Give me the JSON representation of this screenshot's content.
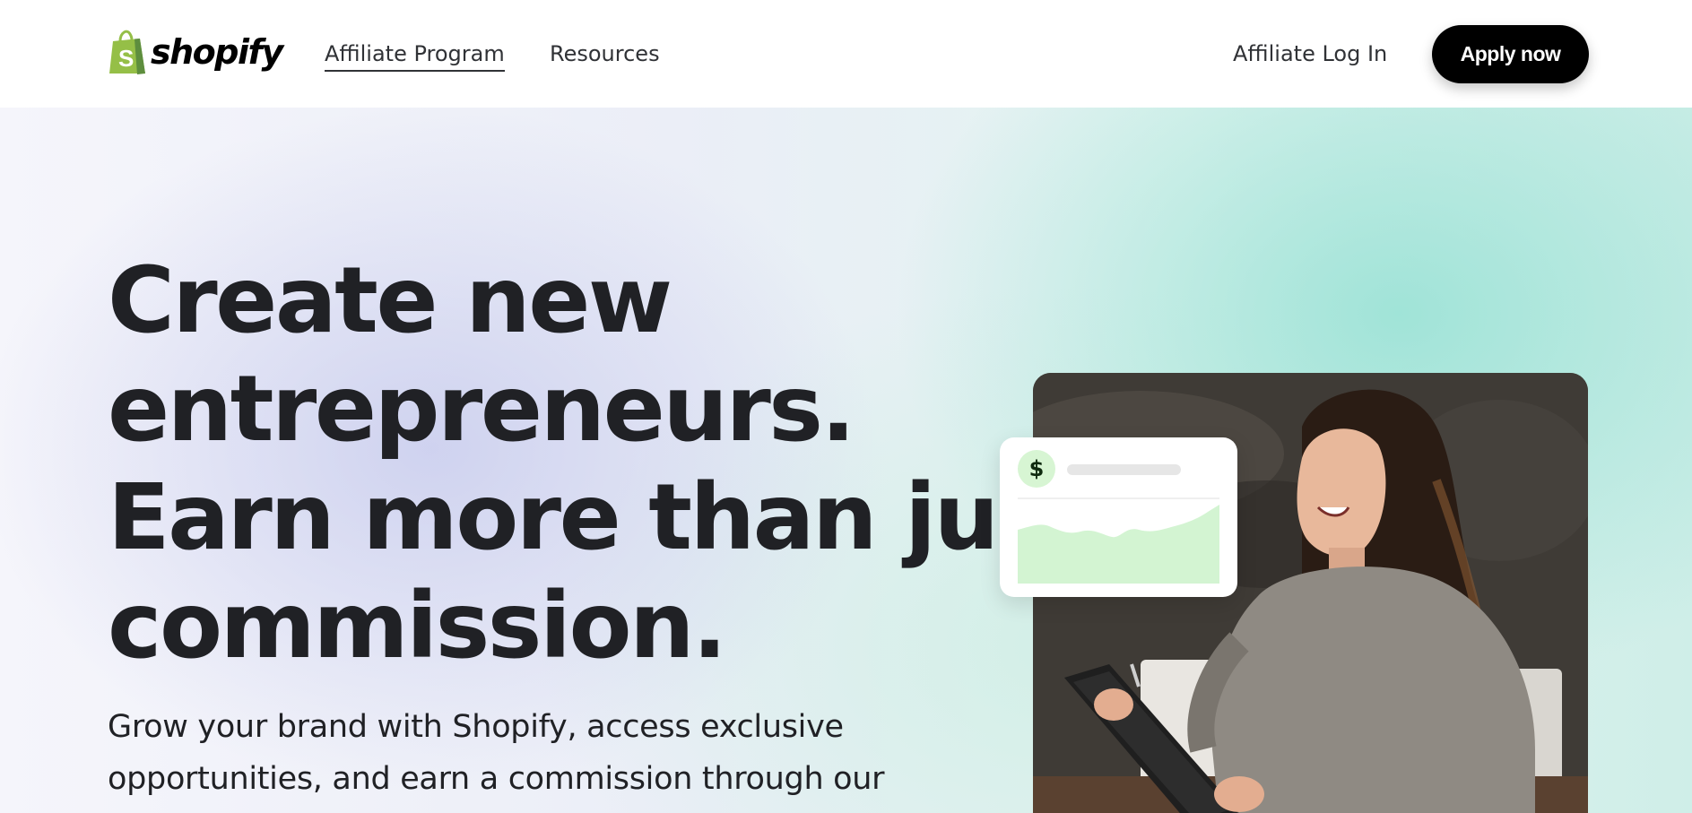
{
  "header": {
    "logo_text": "shopify",
    "nav": {
      "affiliate_program": "Affiliate Program",
      "resources": "Resources"
    },
    "login_label": "Affiliate Log In",
    "apply_label": "Apply now"
  },
  "hero": {
    "headline_lines": [
      "Create new",
      "entrepreneurs.",
      "Earn more than just",
      "commission."
    ],
    "subtext_lines": [
      "Grow your brand with Shopify, access exclusive",
      "opportunities, and earn a commission through our"
    ],
    "card": {
      "currency_symbol": "$",
      "icon": "dollar-icon"
    },
    "photo_icon": "woman-with-tablet-photo"
  },
  "colors": {
    "brand_green": "#95bf47",
    "brand_green_dark": "#5e8e3e",
    "button_bg": "#000000",
    "text": "#202125",
    "card_chart_fill": "#d3f4d2"
  }
}
